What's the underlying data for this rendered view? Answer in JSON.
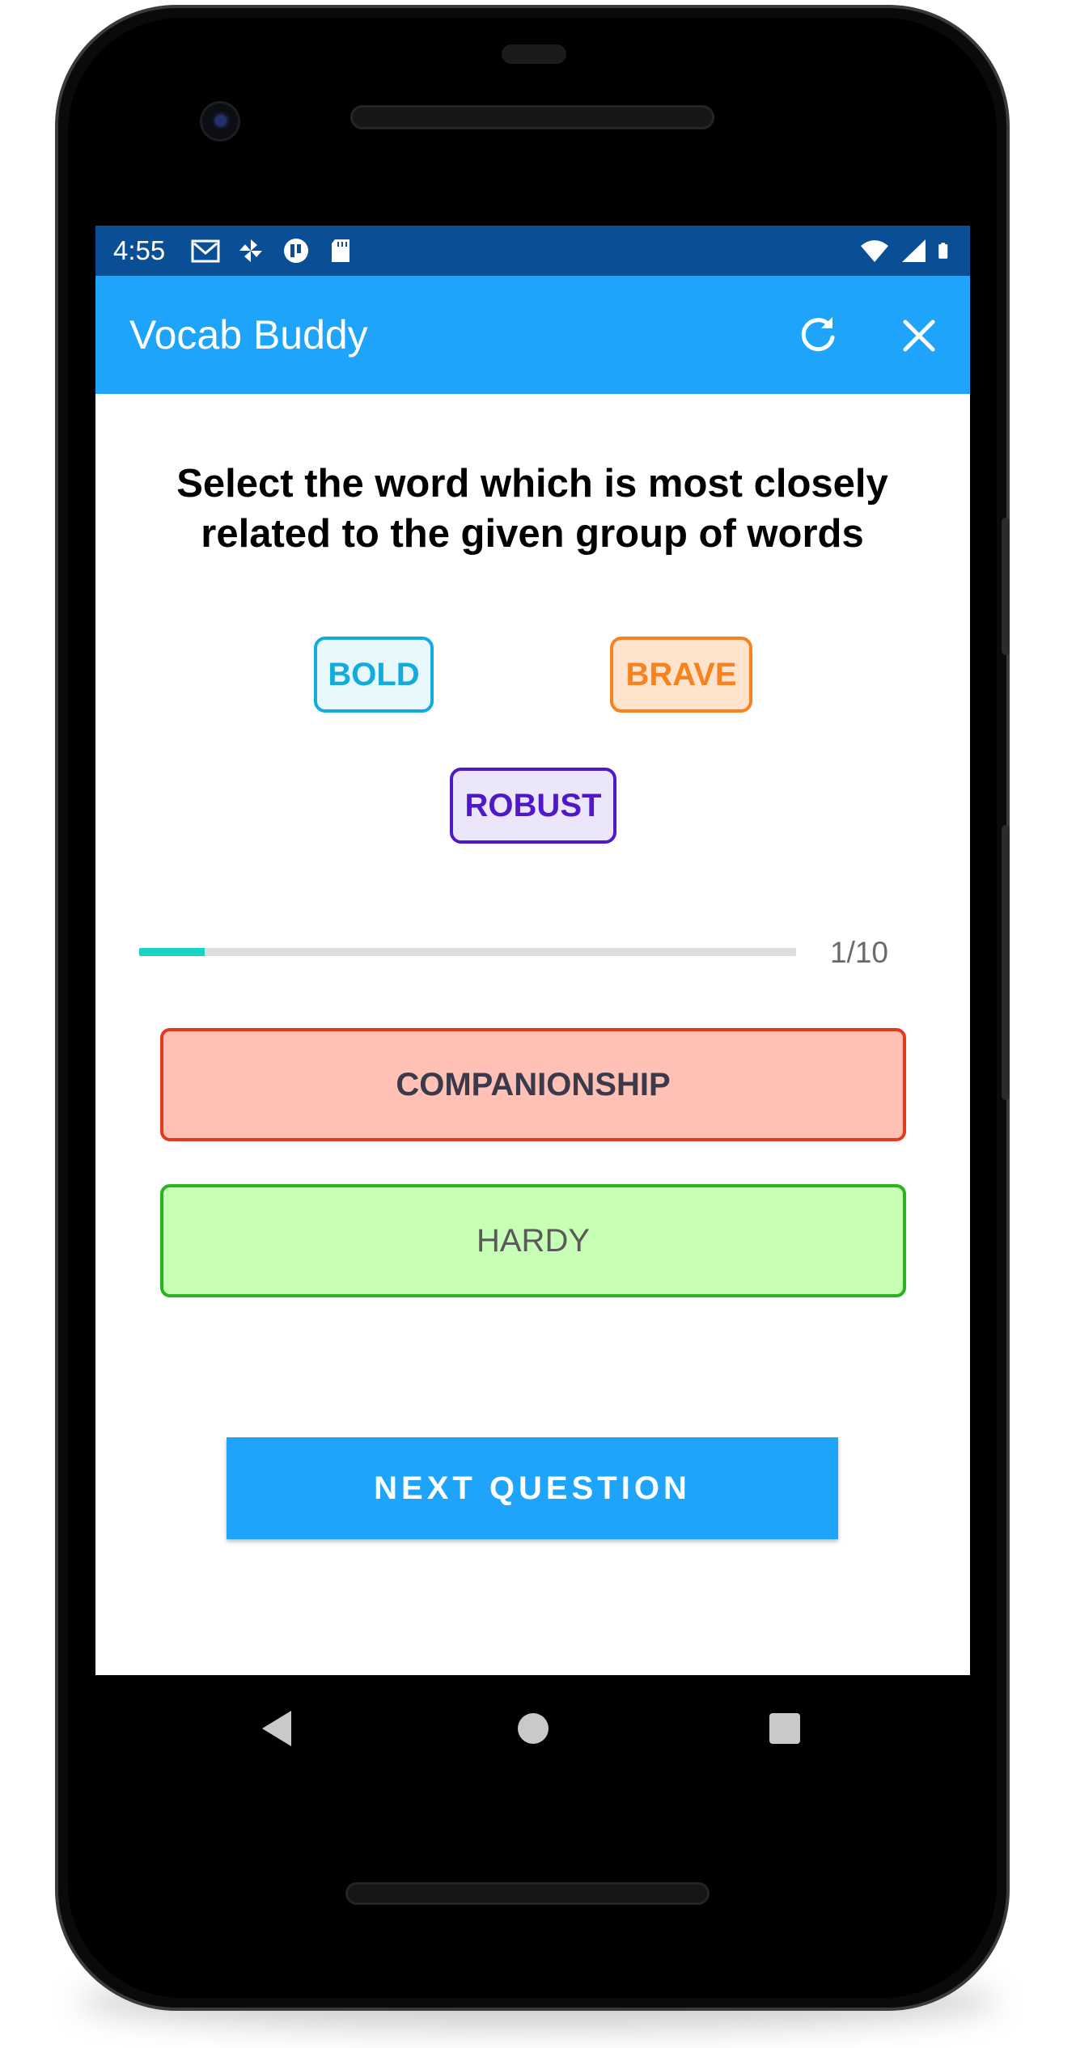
{
  "status_bar": {
    "time": "4:55",
    "left_icons": [
      "gmail-icon",
      "pinwheel-icon",
      "app-icon",
      "sd-card-icon"
    ],
    "right_icons": [
      "wifi-icon",
      "signal-icon",
      "battery-icon"
    ]
  },
  "app_bar": {
    "title": "Vocab Buddy",
    "actions": [
      "refresh-icon",
      "close-icon"
    ]
  },
  "question": {
    "prompt": "Select the word which is most closely related to the given group of words",
    "words": [
      "BOLD",
      "BRAVE",
      "ROBUST"
    ]
  },
  "progress": {
    "label": "1/10",
    "current": 1,
    "total": 10,
    "fraction": 0.1
  },
  "answers": [
    {
      "label": "COMPANIONSHIP",
      "state": "incorrect"
    },
    {
      "label": "HARDY",
      "state": "correct"
    }
  ],
  "next_button": {
    "label": "NEXT QUESTION"
  },
  "colors": {
    "app_bar": "#1ea4fb",
    "status_bar": "#0a4f96",
    "progress_fill": "#1ad4c3",
    "incorrect_bg": "#ffc1b5",
    "incorrect_border": "#e33a1d",
    "correct_bg": "#c6ffb5",
    "correct_border": "#29b31e"
  },
  "nav_bar": [
    "back-icon",
    "home-icon",
    "recents-icon"
  ]
}
